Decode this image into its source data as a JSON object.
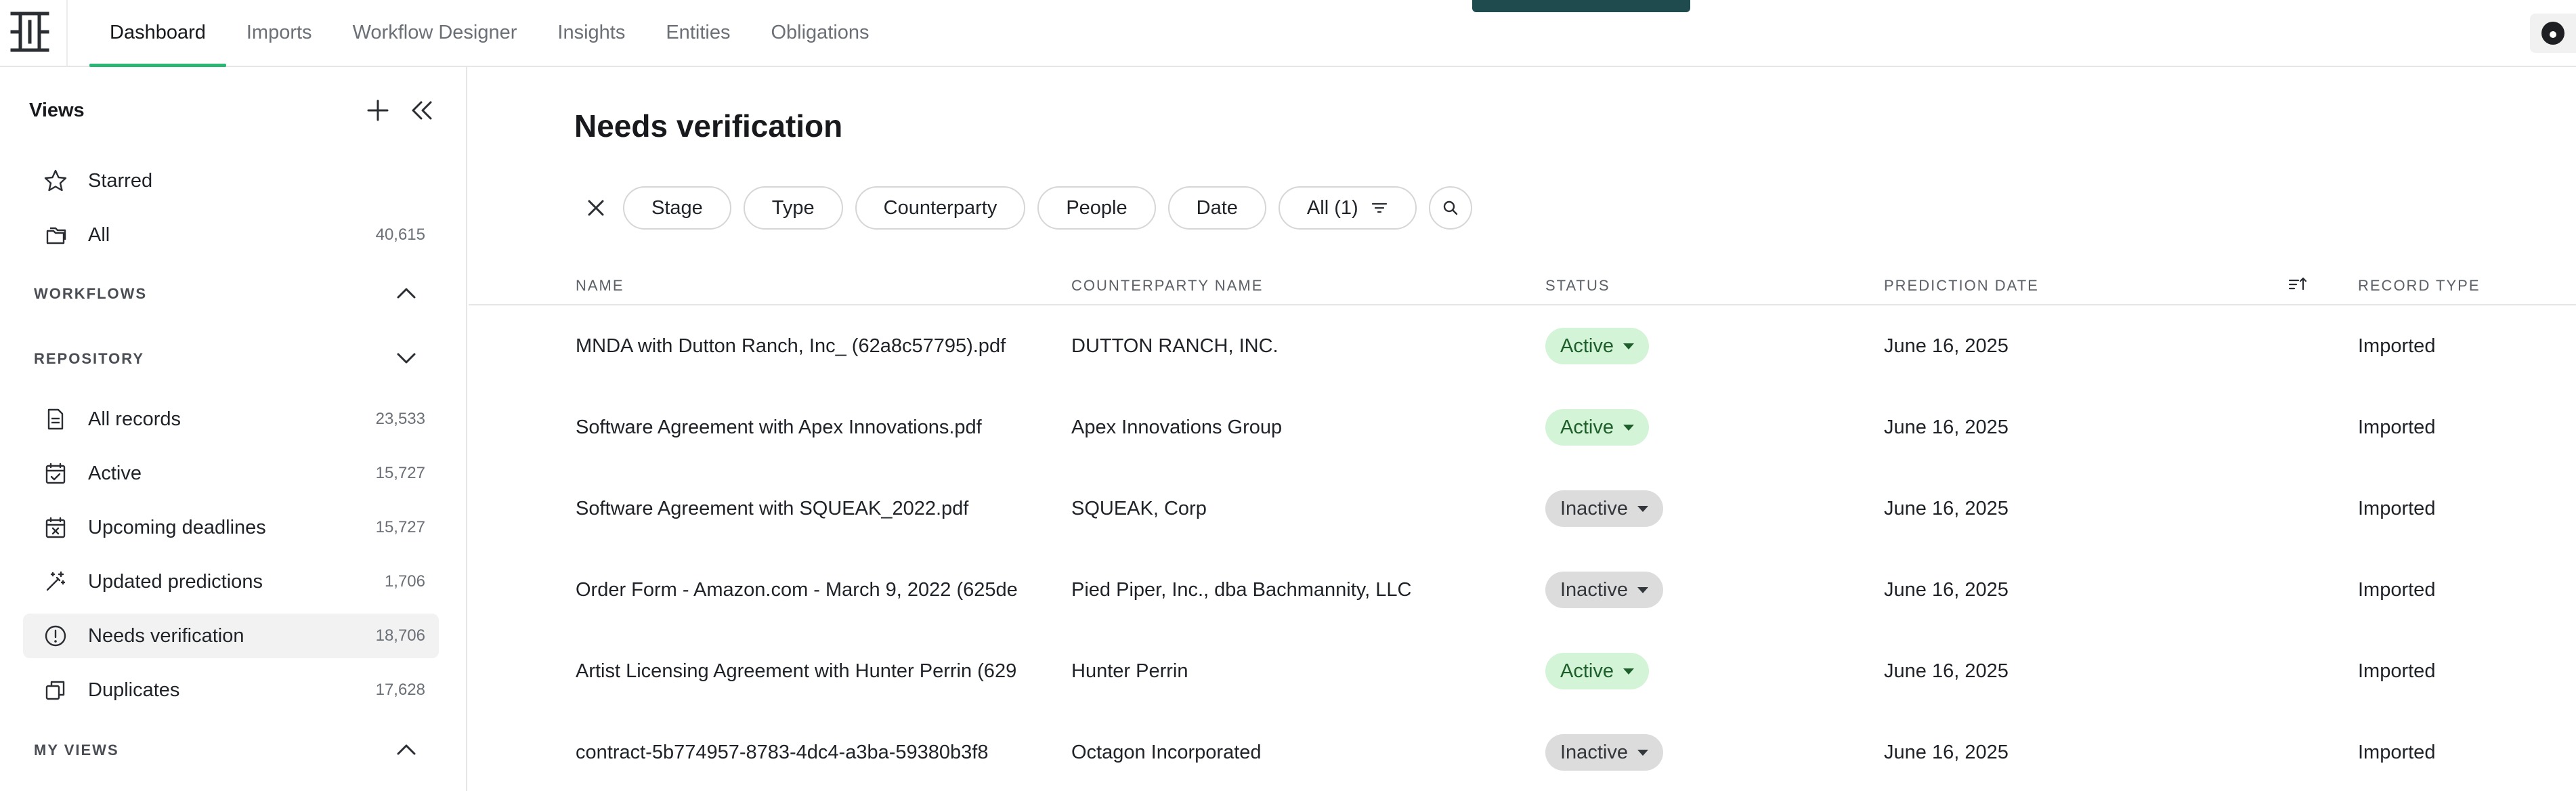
{
  "nav": {
    "tabs": [
      {
        "label": "Dashboard",
        "active": true
      },
      {
        "label": "Imports",
        "active": false
      },
      {
        "label": "Workflow Designer",
        "active": false
      },
      {
        "label": "Insights",
        "active": false
      },
      {
        "label": "Entities",
        "active": false
      },
      {
        "label": "Obligations",
        "active": false
      }
    ]
  },
  "sidebar": {
    "title": "Views",
    "pinned": [
      {
        "label": "Starred",
        "count": "",
        "icon": "star-icon"
      },
      {
        "label": "All",
        "count": "40,615",
        "icon": "folders-icon"
      }
    ],
    "sections": {
      "workflows": "WORKFLOWS",
      "repository": "REPOSITORY",
      "my_views": "MY VIEWS"
    },
    "repository_items": [
      {
        "label": "All records",
        "count": "23,533",
        "icon": "document-icon"
      },
      {
        "label": "Active",
        "count": "15,727",
        "icon": "calendar-check-icon"
      },
      {
        "label": "Upcoming deadlines",
        "count": "15,727",
        "icon": "calendar-x-icon"
      },
      {
        "label": "Updated predictions",
        "count": "1,706",
        "icon": "magic-wand-icon"
      },
      {
        "label": "Needs verification",
        "count": "18,706",
        "icon": "alert-circle-icon",
        "active": true
      },
      {
        "label": "Duplicates",
        "count": "17,628",
        "icon": "duplicate-icon"
      }
    ]
  },
  "main": {
    "title": "Needs verification",
    "filters": [
      "Stage",
      "Type",
      "Counterparty",
      "People",
      "Date"
    ],
    "all_filter": "All (1)",
    "columns": {
      "name": "NAME",
      "counterparty": "COUNTERPARTY NAME",
      "status": "STATUS",
      "prediction_date": "PREDICTION DATE",
      "record_type": "RECORD TYPE"
    },
    "rows": [
      {
        "name": "MNDA with Dutton Ranch, Inc_ (62a8c57795).pdf",
        "counterparty": "DUTTON RANCH, INC.",
        "status": "Active",
        "date": "June 16, 2025",
        "type": "Imported"
      },
      {
        "name": "Software Agreement with Apex Innovations.pdf",
        "counterparty": "Apex Innovations Group",
        "status": "Active",
        "date": "June 16, 2025",
        "type": "Imported"
      },
      {
        "name": "Software Agreement with SQUEAK_2022.pdf",
        "counterparty": "SQUEAK, Corp",
        "status": "Inactive",
        "date": "June 16, 2025",
        "type": "Imported"
      },
      {
        "name": "Order Form - Amazon.com - March 9, 2022 (625de",
        "counterparty": "Pied Piper, Inc., dba Bachmannity, LLC",
        "status": "Inactive",
        "date": "June 16, 2025",
        "type": "Imported"
      },
      {
        "name": "Artist Licensing Agreement with Hunter Perrin (629",
        "counterparty": "Hunter Perrin",
        "status": "Active",
        "date": "June 16, 2025",
        "type": "Imported"
      },
      {
        "name": "contract-5b774957-8783-4dc4-a3ba-59380b3f8",
        "counterparty": "Octagon Incorporated",
        "status": "Inactive",
        "date": "June 16, 2025",
        "type": "Imported"
      }
    ]
  },
  "colors": {
    "accent_green": "#2bb673",
    "active_badge_bg": "#d3f4d6",
    "inactive_badge_bg": "#dcdcdd",
    "top_dark": "#1f4a4e"
  }
}
